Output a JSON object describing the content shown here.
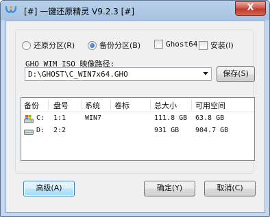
{
  "window": {
    "title": "[#] 一键还原精灵 V9.2.3 [#]",
    "close_label": "X"
  },
  "mode_options": [
    {
      "label": "还原分区(R)",
      "checked": false
    },
    {
      "label": "备份分区(B)",
      "checked": true
    }
  ],
  "checkboxes": [
    {
      "label": "Ghost64",
      "checked": false
    },
    {
      "label": "安装(I)",
      "checked": false
    }
  ],
  "path": {
    "label": "GHO WIM ISO 映像路径:",
    "value": "D:\\GHOST\\C_WIN7x64.GHO"
  },
  "save_label": "保存(S)",
  "table": {
    "columns": [
      "备份",
      "盘号",
      "系统",
      "卷标",
      "总大小",
      "可用空间"
    ],
    "rows": [
      {
        "drive": "C:",
        "disk_no": "1:1",
        "system": "WIN7",
        "label": "",
        "total": "111.8 GB",
        "free": "63.8 GB",
        "icon": "windows-drive-icon"
      },
      {
        "drive": "D:",
        "disk_no": "2:2",
        "system": "",
        "label": "",
        "total": "931 GB",
        "free": "904.7 GB",
        "icon": "hard-drive-icon"
      }
    ]
  },
  "buttons": {
    "advanced": "高级(A)",
    "ok": "确定(Y)",
    "cancel": "取消(C)"
  },
  "colors": {
    "titlebar": "#a6c2e2",
    "close": "#c0392b",
    "dialog_bg": "#f0f0f0"
  }
}
